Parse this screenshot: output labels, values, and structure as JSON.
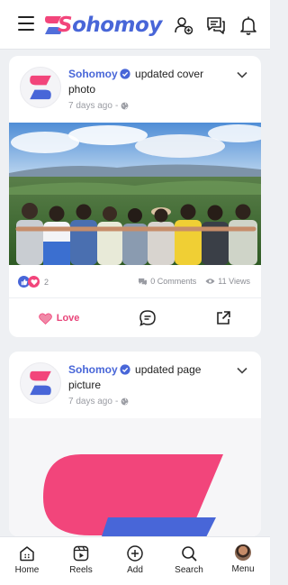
{
  "header": {
    "brand": "Sohomoy"
  },
  "posts": [
    {
      "author": "Sohomoy",
      "action": "updated cover photo",
      "time": "7 days ago",
      "separator": "-",
      "reactions": "2",
      "comments": "0 Comments",
      "views": "11 Views",
      "love_label": "Love"
    },
    {
      "author": "Sohomoy",
      "action": "updated page picture",
      "time": "7 days ago",
      "separator": "-"
    }
  ],
  "bottom_nav": {
    "items": [
      {
        "label": "Home"
      },
      {
        "label": "Reels"
      },
      {
        "label": "Add"
      },
      {
        "label": "Search"
      },
      {
        "label": "Menu"
      }
    ]
  },
  "colors": {
    "brand_blue": "#4866d8",
    "brand_pink": "#f2457b"
  }
}
